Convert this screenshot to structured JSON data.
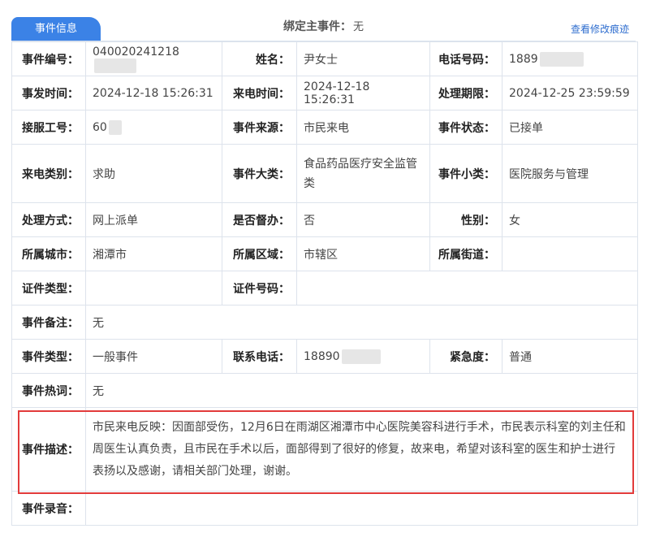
{
  "tab": {
    "label": "事件信息"
  },
  "bind_main": {
    "label": "绑定主事件：",
    "value": "无"
  },
  "history_link": "查看修改痕迹",
  "fields": {
    "event_no": {
      "label": "事件编号：",
      "value": "040020241218"
    },
    "name": {
      "label": "姓名：",
      "value": "尹女士"
    },
    "phone": {
      "label": "电话号码：",
      "value": "1889"
    },
    "occur_time": {
      "label": "事发时间：",
      "value": "2024-12-18 15:26:31"
    },
    "call_time": {
      "label": "来电时间：",
      "value": "2024-12-18 15:26:31"
    },
    "deadline": {
      "label": "处理期限：",
      "value": "2024-12-25 23:59:59"
    },
    "agent_no": {
      "label": "接服工号：",
      "value": "60"
    },
    "source": {
      "label": "事件来源：",
      "value": "市民来电"
    },
    "status": {
      "label": "事件状态：",
      "value": "已接单"
    },
    "call_type": {
      "label": "来电类别：",
      "value": "求助"
    },
    "major_cat": {
      "label": "事件大类：",
      "value": "食品药品医疗安全监管类"
    },
    "minor_cat": {
      "label": "事件小类：",
      "value": "医院服务与管理"
    },
    "method": {
      "label": "处理方式：",
      "value": "网上派单"
    },
    "supervise": {
      "label": "是否督办：",
      "value": "否"
    },
    "gender": {
      "label": "性别：",
      "value": "女"
    },
    "city": {
      "label": "所属城市：",
      "value": "湘潭市"
    },
    "district": {
      "label": "所属区域：",
      "value": "市辖区"
    },
    "street": {
      "label": "所属街道：",
      "value": ""
    },
    "id_type": {
      "label": "证件类型：",
      "value": ""
    },
    "id_no": {
      "label": "证件号码：",
      "value": ""
    },
    "remark": {
      "label": "事件备注：",
      "value": "无"
    },
    "event_type": {
      "label": "事件类型：",
      "value": "一般事件"
    },
    "contact": {
      "label": "联系电话：",
      "value": "18890"
    },
    "urgency": {
      "label": "紧急度：",
      "value": "普通"
    },
    "hot_words": {
      "label": "事件热词：",
      "value": "无"
    },
    "description": {
      "label": "事件描述：",
      "value": "市民来电反映：因面部受伤，12月6日在雨湖区湘潭市中心医院美容科进行手术，市民表示科室的刘主任和周医生认真负责，且市民在手术以后，面部得到了很好的修复，故来电，希望对该科室的医生和护士进行表扬以及感谢，请相关部门处理，谢谢。"
    },
    "recording": {
      "label": "事件录音：",
      "value": ""
    }
  },
  "colors": {
    "accent": "#3b82e6",
    "highlight_border": "#e23b3b",
    "link": "#2f6ecf"
  }
}
